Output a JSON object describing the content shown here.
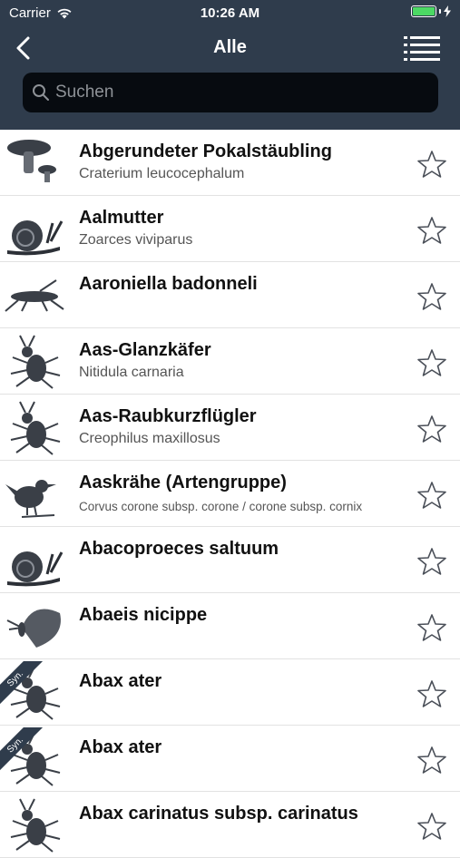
{
  "status_bar": {
    "carrier": "Carrier",
    "time": "10:26 AM"
  },
  "nav": {
    "title": "Alle",
    "back_icon": "chevron-left-icon",
    "list_icon": "list-icon"
  },
  "search": {
    "placeholder": "Suchen",
    "value": ""
  },
  "colors": {
    "header": "#2f3c4c",
    "search_bg": "#070b10",
    "battery": "#4cd964"
  },
  "items": [
    {
      "name": "Abgerundeter Pokalstäubling",
      "sci": "Craterium leucocephalum",
      "icon": "mushroom-icon",
      "syn": ""
    },
    {
      "name": "Aalmutter",
      "sci": "Zoarces viviparus",
      "icon": "snail-icon",
      "syn": ""
    },
    {
      "name": "Aaroniella badonneli",
      "sci": "",
      "icon": "grasshopper-icon",
      "syn": ""
    },
    {
      "name": "Aas-Glanzkäfer",
      "sci": "Nitidula carnaria",
      "icon": "beetle-icon",
      "syn": ""
    },
    {
      "name": "Aas-Raubkurzflügler",
      "sci": "Creophilus maxillosus",
      "icon": "beetle-icon",
      "syn": ""
    },
    {
      "name": "Aaskrähe (Artengruppe)",
      "sci": "Corvus corone subsp. corone / corone subsp. cornix",
      "icon": "bird-icon",
      "syn": ""
    },
    {
      "name": "Abacoproeces saltuum",
      "sci": "",
      "icon": "snail-icon",
      "syn": ""
    },
    {
      "name": "Abaeis nicippe",
      "sci": "",
      "icon": "butterfly-icon",
      "syn": ""
    },
    {
      "name": "Abax ater",
      "sci": "",
      "icon": "beetle-icon",
      "syn": "Syn."
    },
    {
      "name": "Abax ater",
      "sci": "",
      "icon": "beetle-icon",
      "syn": "Syn."
    },
    {
      "name": "Abax carinatus subsp. carinatus",
      "sci": "",
      "icon": "beetle-icon",
      "syn": ""
    }
  ]
}
